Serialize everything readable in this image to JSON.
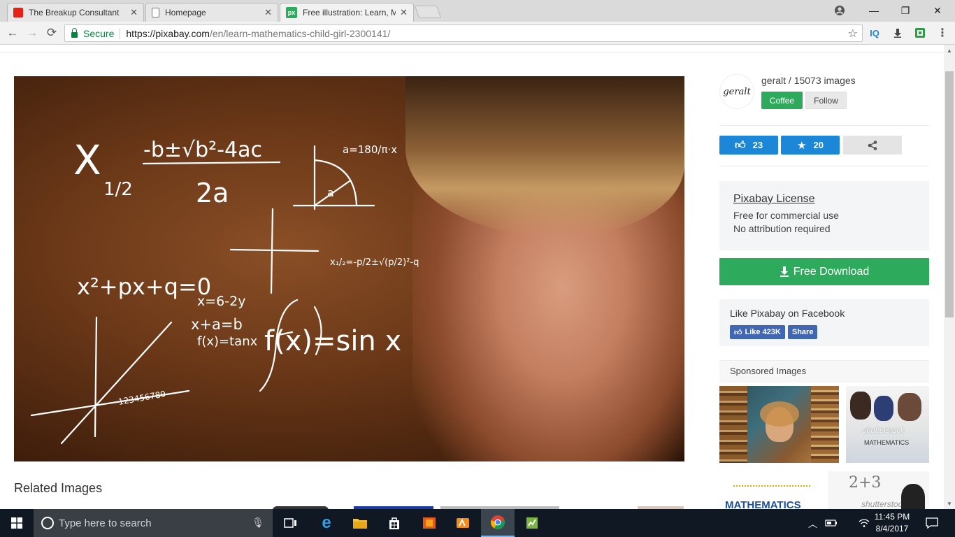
{
  "browser": {
    "tabs": [
      {
        "title": "The Breakup Consultant",
        "icon": "youtube-icon",
        "active": false
      },
      {
        "title": "Homepage",
        "icon": "page-icon",
        "active": false
      },
      {
        "title": "Free illustration: Learn, M",
        "icon": "pixabay-icon",
        "active": true
      }
    ],
    "secure_label": "Secure",
    "url_host": "https://pixabay.com",
    "url_path": "/en/learn-mathematics-child-girl-2300141/",
    "extensions": [
      "IQ",
      "download-icon",
      "extension-icon"
    ]
  },
  "hero": {
    "alt": "learn mathematics child girl",
    "formulas": {
      "quadratic_lhs": "X",
      "quadratic_sub": "1/2",
      "quadratic_num": "-b±√b²-4ac",
      "quadratic_den": "2a",
      "angle": "a=180/π·x",
      "angle_label": "a",
      "pq": "x²+px+q=0",
      "x_eq": "x=6-2y",
      "x_plus": "x+a=b",
      "fx_tan": "f(x)=tanx",
      "fx_sin": "f(x)=sin x",
      "pq_solution": "x₁/₂=-p/2±√(p/2)²-q",
      "axis_numbers": "123456789"
    }
  },
  "related": {
    "title": "Related Images"
  },
  "sidebar": {
    "author": {
      "avatar_text": "geralt",
      "name_line": "geralt / 15073 images",
      "coffee": "Coffee",
      "follow": "Follow"
    },
    "likes": "23",
    "favorites": "20",
    "license": {
      "title": "Pixabay License",
      "line1": "Free for commercial use",
      "line2": "No attribution required"
    },
    "download": "Free Download",
    "facebook": {
      "title": "Like Pixabay on Facebook",
      "like": "Like 423K",
      "share": "Share"
    },
    "sponsored": {
      "title": "Sponsored Images",
      "watermark": "shutterstock",
      "mathematics": "MATHEMATICS",
      "chalk": "2+3"
    }
  },
  "taskbar": {
    "search_placeholder": "Type here to search",
    "time": "11:45 PM",
    "date": "8/4/2017"
  },
  "colors": {
    "green": "#2daa5c",
    "blue": "#1c87d6",
    "taskbar": "#101923"
  }
}
